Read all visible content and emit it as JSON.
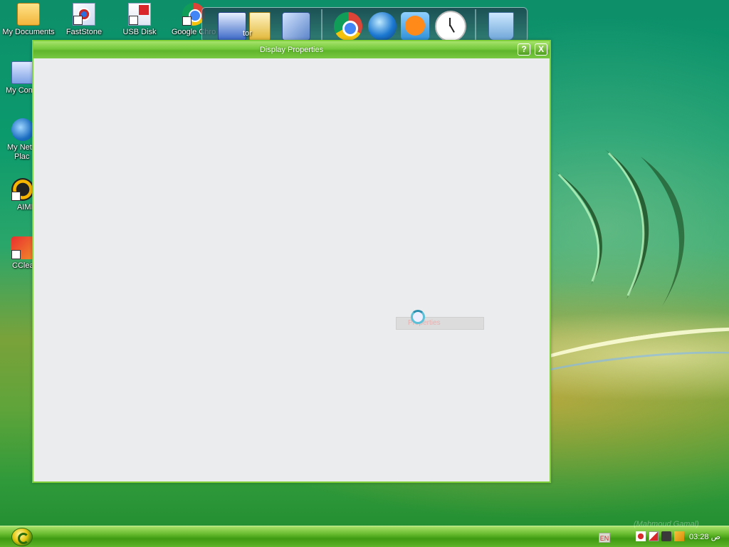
{
  "desktop": {
    "icons": [
      {
        "label": "My Documents",
        "icon": "folder-icon"
      },
      {
        "label": "FastStone",
        "icon": "faststone-icon"
      },
      {
        "label": "USB Disk",
        "icon": "usb-disk-icon"
      },
      {
        "label": "Google Chrome",
        "icon": "chrome-icon"
      },
      {
        "label": "My Computer",
        "icon": "computer-icon"
      },
      {
        "label": "My Network Places",
        "icon": "network-icon"
      },
      {
        "label": "AIMP",
        "icon": "aimp-icon"
      },
      {
        "label": "CCleaner",
        "icon": "ccleaner-icon"
      }
    ],
    "visible_labels": [
      "My Documents",
      "FastStone",
      "USB Disk",
      "Google Chro",
      "My Com",
      "My Net",
      "Plac",
      "AIMI",
      "CClea"
    ]
  },
  "dock": {
    "items": [
      "my-computer-icon",
      "my-documents-icon",
      "disk-icon",
      "chrome-icon",
      "globe-icon",
      "media-player-icon",
      "clock-icon",
      "recycle-bin-icon"
    ],
    "partial_label": "tor"
  },
  "window": {
    "title": "Display Properties",
    "help_button": "?",
    "close_button": "X",
    "loading_text": "Properties"
  },
  "taskbar": {
    "language": "EN",
    "clock": "03:28 ص",
    "watermark": "(Mahmoud Gamal)"
  },
  "colors": {
    "window_border": "#7fcf3a",
    "titlebar": "#74c83b",
    "window_body": "#ebecee",
    "taskbar": "#5fb42a"
  }
}
